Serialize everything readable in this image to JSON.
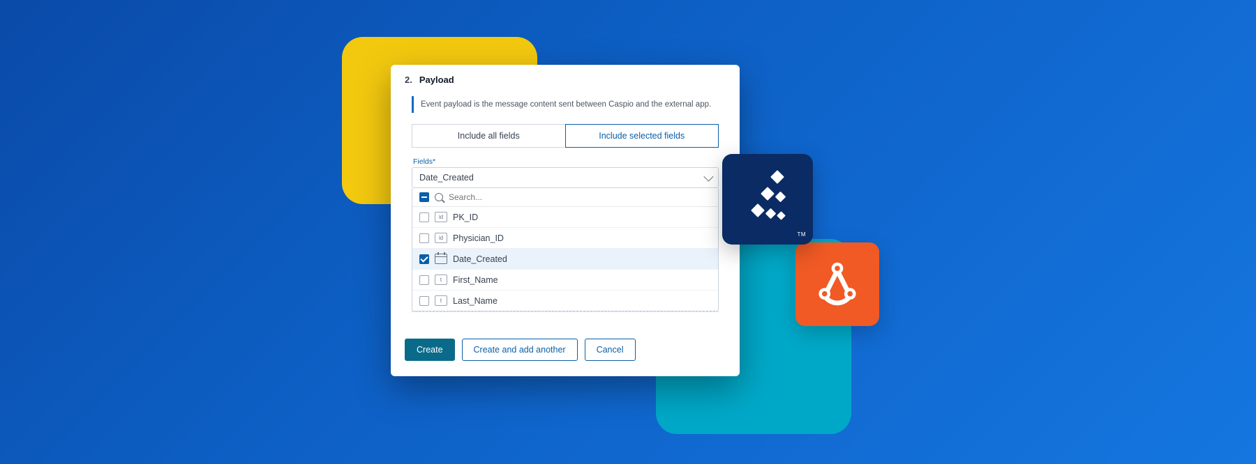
{
  "panel": {
    "step_number": "2.",
    "step_title": "Payload",
    "info_text": "Event payload is the message content sent between Caspio and the external app.",
    "toggle": {
      "all": "Include all fields",
      "selected": "Include selected fields"
    },
    "fields_label": "Fields*",
    "selected_field": "Date_Created",
    "search_placeholder": "Search...",
    "rows": [
      {
        "type": "id",
        "label": "PK_ID",
        "checked": false
      },
      {
        "type": "id",
        "label": "Physician_ID",
        "checked": false
      },
      {
        "type": "date",
        "label": "Date_Created",
        "checked": true
      },
      {
        "type": "t",
        "label": "First_Name",
        "checked": false
      },
      {
        "type": "t",
        "label": "Last_Name",
        "checked": false
      }
    ],
    "buttons": {
      "create": "Create",
      "create_another": "Create and add another",
      "cancel": "Cancel"
    }
  },
  "navy_tm": "TM"
}
